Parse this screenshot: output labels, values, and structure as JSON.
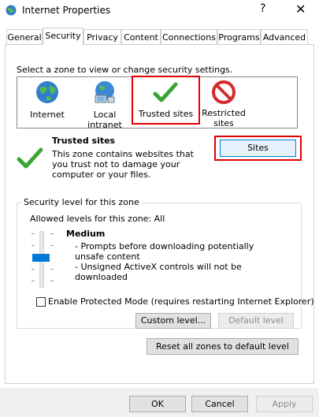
{
  "window": {
    "title": "Internet Properties",
    "help_label": "?",
    "close_label": "✕"
  },
  "tabs": [
    {
      "label": "General"
    },
    {
      "label": "Security"
    },
    {
      "label": "Privacy"
    },
    {
      "label": "Content"
    },
    {
      "label": "Connections"
    },
    {
      "label": "Programs"
    },
    {
      "label": "Advanced"
    }
  ],
  "active_tab": "Security",
  "security": {
    "instruction": "Select a zone to view or change security settings.",
    "zones": [
      {
        "label": "Internet",
        "icon": "globe-icon"
      },
      {
        "label": "Local intranet",
        "icon": "intranet-icon"
      },
      {
        "label": "Trusted sites",
        "icon": "checkmark-icon"
      },
      {
        "label": "Restricted sites",
        "icon": "restricted-icon"
      }
    ],
    "selected_zone": "Trusted sites",
    "zone_title": "Trusted sites",
    "zone_description": "This zone contains websites that you trust not to damage your computer or your files.",
    "sites_button": "Sites",
    "group_title": "Security level for this zone",
    "allowed_levels": "Allowed levels for this zone: All",
    "level_name": "Medium",
    "level_bullets": [
      "- Prompts before downloading potentially unsafe content",
      "- Unsigned ActiveX controls will not be downloaded"
    ],
    "protected_mode_label": "Enable Protected Mode (requires restarting Internet Explorer)",
    "protected_mode_checked": false,
    "custom_level_button": "Custom level...",
    "default_level_button": "Default level",
    "reset_button": "Reset all zones to default level"
  },
  "footer": {
    "ok": "OK",
    "cancel": "Cancel",
    "apply": "Apply"
  },
  "colors": {
    "accent": "#0078d7",
    "highlight_red": "#e00000",
    "check_green": "#3aa535"
  }
}
